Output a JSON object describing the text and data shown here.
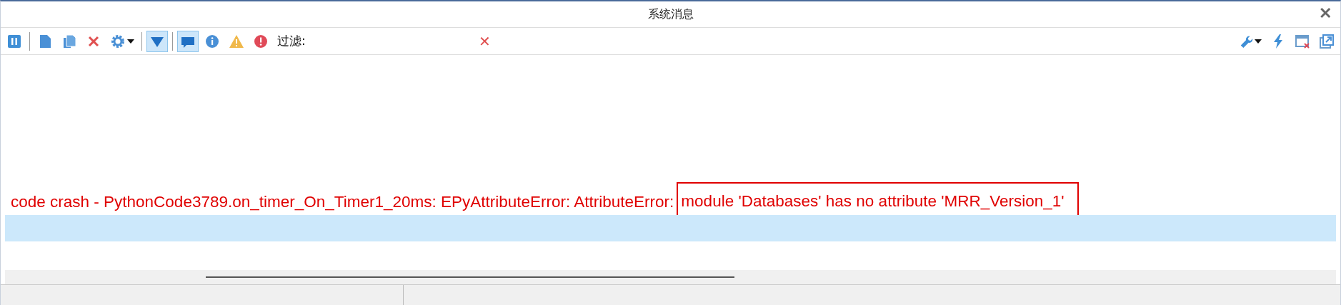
{
  "window": {
    "title": "系统消息",
    "close_label": "✕"
  },
  "toolbar": {
    "buttons": [
      {
        "kind": "pause",
        "on": false
      },
      {
        "kind": "document",
        "on": false
      },
      {
        "kind": "copy",
        "on": false
      },
      {
        "kind": "delete",
        "on": false
      },
      {
        "kind": "settings",
        "on": false
      },
      {
        "kind": "filter",
        "on": true
      },
      {
        "kind": "message",
        "on": true
      },
      {
        "kind": "info",
        "on": false
      },
      {
        "kind": "warning",
        "on": false
      },
      {
        "kind": "error",
        "on": false
      }
    ],
    "filter": {
      "label": "过滤:",
      "clear_label": "✕"
    },
    "right_buttons": [
      {
        "kind": "wrench"
      },
      {
        "kind": "bolt"
      },
      {
        "kind": "close-window"
      },
      {
        "kind": "popout"
      }
    ]
  },
  "messages": [
    {
      "text": "code crash - PythonCode3789.on_timer_On_Timer1_20ms: EPyAttributeError: AttributeError:",
      "highlighted_text": "module 'Databases' has no attribute 'MRR_Version_1'",
      "selected": false
    },
    {
      "selected": true
    }
  ]
}
